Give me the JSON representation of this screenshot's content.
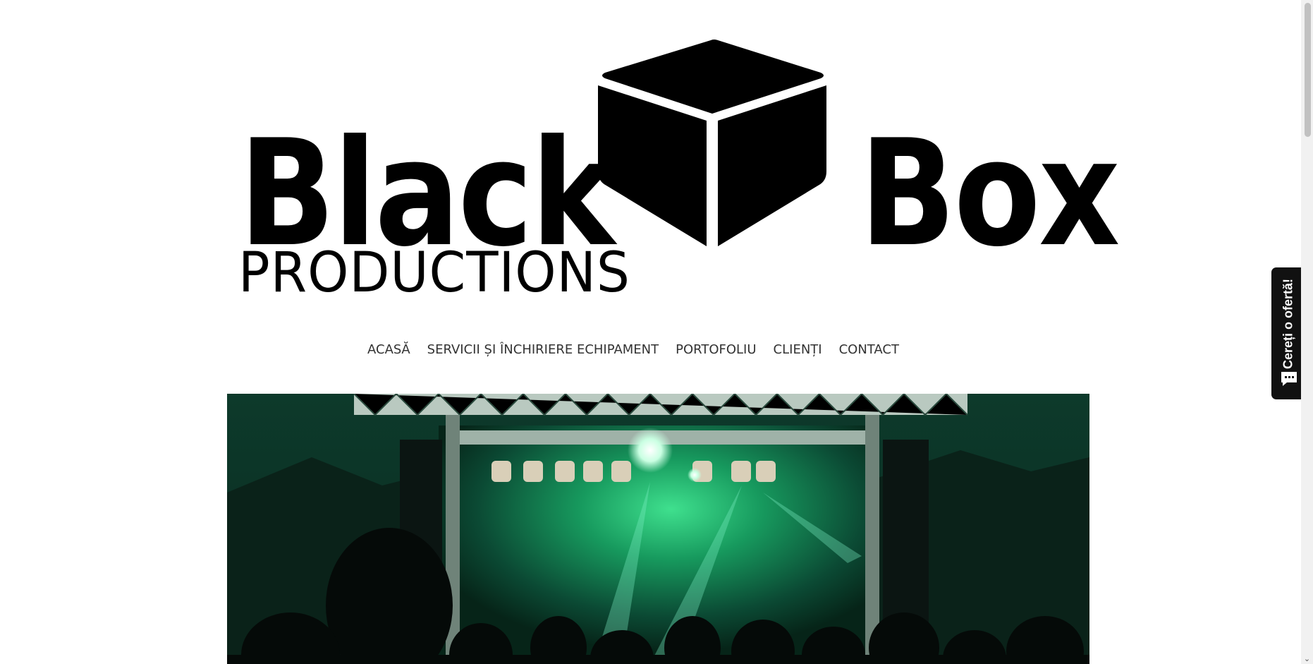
{
  "logo": {
    "word_left": "Black",
    "word_right": "Box",
    "subtitle": "PRODUCTIONS",
    "icon": "cube-icon"
  },
  "nav": {
    "items": [
      {
        "label": "ACASĂ"
      },
      {
        "label": "SERVICII ȘI ÎNCHIRIERE ECHIPAMENT"
      },
      {
        "label": "PORTOFOLIU"
      },
      {
        "label": "CLIENȚI"
      },
      {
        "label": "CONTACT"
      }
    ]
  },
  "hero": {
    "image": "concert-stage-photo",
    "accent_color": "#1fa36a"
  },
  "quote_tab": {
    "label": "Cereți o ofertă!",
    "icon": "chat-bubble-icon"
  },
  "colors": {
    "text": "#333333",
    "logo": "#000000",
    "tab_bg": "#111111"
  }
}
